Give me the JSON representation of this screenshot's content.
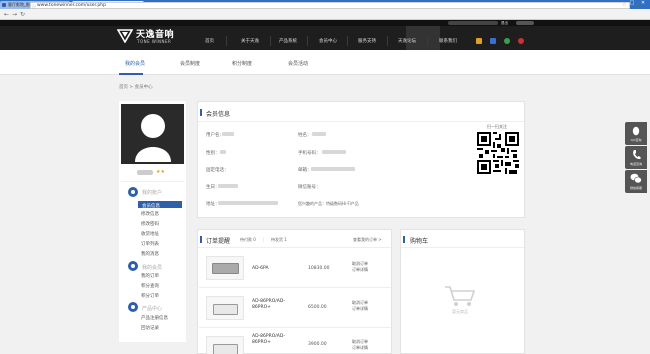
{
  "browser": {
    "tabs": [
      {
        "label": "客厅影院_影院音响_HiFi音响..."
      },
      {
        "label": "用户中心_天逸音响"
      }
    ],
    "url": "www.tonewinner.com/user.php"
  },
  "header": {
    "logo_cn": "天逸音响",
    "logo_en": "TONE WINNER",
    "nav": [
      "首页",
      "关于天逸",
      "产品系统",
      "会员中心",
      "服务支持",
      "天逸论坛",
      "联系我们"
    ],
    "logout": "退出"
  },
  "subnav": {
    "items": [
      "我的会员",
      "会员制度",
      "积分制度",
      "会员活动"
    ],
    "active": 0
  },
  "breadcrumb": "首页 > 会员中心",
  "sidebar": {
    "sections": [
      {
        "title": "我的账户",
        "items": [
          "会员信息",
          "修改信息",
          "修改密码",
          "收货地址",
          "订单列表",
          "我的消息"
        ]
      },
      {
        "title": "我的会员",
        "items": [
          "我的订单",
          "积分查询",
          "积分订单"
        ]
      },
      {
        "title": "产品中心",
        "items": [
          "产品注册信息",
          "回访记录"
        ]
      }
    ],
    "active_item": "会员信息"
  },
  "member_info": {
    "title": "会员信息",
    "fields": [
      {
        "label": "用户名："
      },
      {
        "label": "姓名："
      },
      {
        "label": "性别："
      },
      {
        "label": "手机号码："
      },
      {
        "label": "固定电话："
      },
      {
        "label": "邮箱："
      },
      {
        "label": "生日："
      },
      {
        "label": "微信账号："
      },
      {
        "label": "地址："
      }
    ],
    "preference": "您兴趣的产品：特级数码Hi-Fi产品",
    "qr_caption": "扫一扫关注"
  },
  "orders": {
    "title": "订单提醒",
    "tabs": [
      "待付款 0",
      "待发货 1"
    ],
    "view_all": "查看我的订单 >",
    "rows": [
      {
        "name": "AD-6PA",
        "price": "10830.00",
        "actions": [
          "取消订单",
          "订单详情"
        ]
      },
      {
        "name": "AD-86PRO/AD-86PRO+",
        "price": "6500.00",
        "actions": [
          "取消订单",
          "订单详情"
        ]
      },
      {
        "name": "AD-86PRO/AD-86PRO+",
        "price": "3900.00",
        "actions": [
          "取消订单",
          "订单详情"
        ]
      }
    ]
  },
  "cart": {
    "title": "购物车",
    "empty_text": "暂无商品"
  },
  "float_buttons": [
    "QQ咨询",
    "电话咨询",
    "微信客服"
  ],
  "colors": {
    "brand_blue": "#2e5fab",
    "header_bg": "#1e1e1e",
    "page_bg": "#f1f1f1"
  }
}
